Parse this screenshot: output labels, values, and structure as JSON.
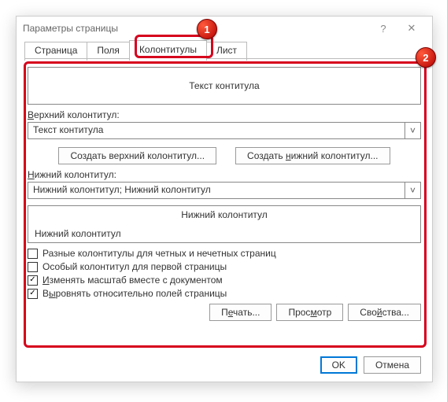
{
  "titlebar": {
    "title": "Параметры страницы",
    "help": "?",
    "close": "✕"
  },
  "tabs": [
    "Страница",
    "Поля",
    "Колонтитулы",
    "Лист"
  ],
  "active_tab": 2,
  "header_preview": "Текст контитула",
  "labels": {
    "header": "Верхний колонтитул:",
    "footer": "Нижний колонтитул:"
  },
  "header_combo": "Текст контитула",
  "footer_combo": "Нижний колонтитул; Нижний колонтитул",
  "buttons": {
    "create_header": "Создать верхний колонтитул...",
    "create_footer": "Создать нижний колонтитул...",
    "print": "Печать...",
    "preview": "Просмотр",
    "properties": "Свойства...",
    "ok": "OK",
    "cancel": "Отмена"
  },
  "footer_preview": {
    "center": "Нижний колонтитул",
    "left": "Нижний колонтитул"
  },
  "checks": [
    {
      "label": "Разные колонтитулы для четных и нечетных страниц",
      "checked": false
    },
    {
      "label": "Особый колонтитул для первой страницы",
      "checked": false
    },
    {
      "label": "Изменять масштаб вместе с документом",
      "checked": true
    },
    {
      "label": "Выровнять относительно полей страницы",
      "checked": true
    }
  ],
  "badges": {
    "one": "1",
    "two": "2"
  }
}
